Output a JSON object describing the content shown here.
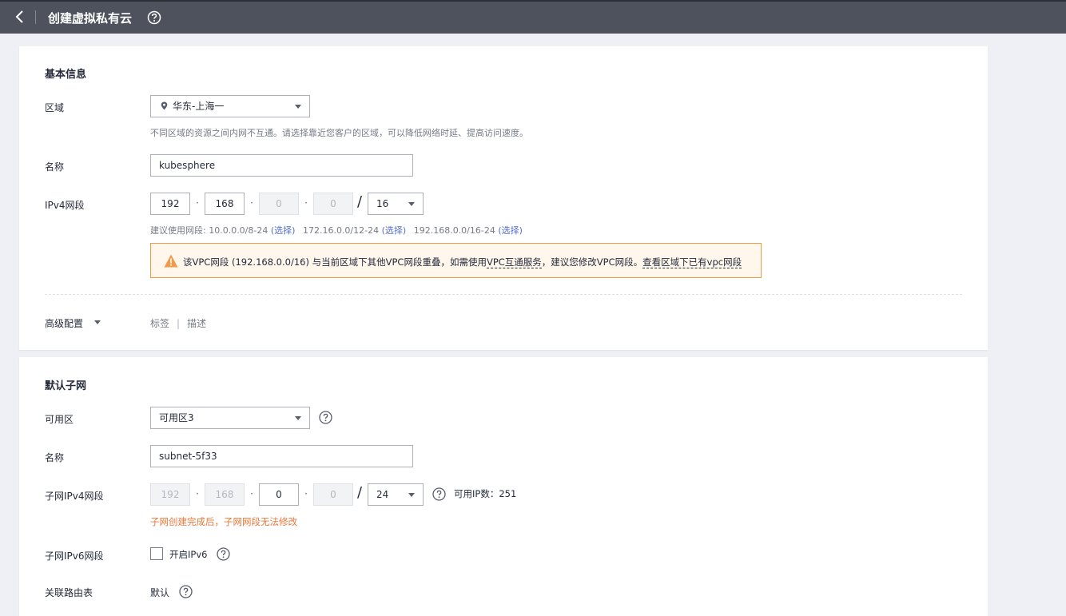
{
  "header": {
    "title": "创建虚拟私有云"
  },
  "basic": {
    "section_title": "基本信息",
    "region_label": "区域",
    "region_value": "华东-上海一",
    "region_hint": "不同区域的资源之间内网不互通。请选择靠近您客户的区域，可以降低网络时延、提高访问速度。",
    "name_label": "名称",
    "name_value": "kubesphere",
    "ipv4_label": "IPv4网段",
    "ip": {
      "o1": "192",
      "o2": "168",
      "o3": "0",
      "o4": "0",
      "mask": "16"
    },
    "suggest_prefix": "建议使用网段: 10.0.0.0/8-24",
    "suggest_2": "172.16.0.0/12-24",
    "suggest_3": "192.168.0.0/16-24",
    "select_link": "(选择)",
    "warning": {
      "text_1": "该VPC网段 (192.168.0.0/16) 与当前区域下其他VPC网段重叠，如需使用",
      "link_1": "VPC互通服务",
      "text_2": "，建议您修改VPC网段。",
      "link_2": "查看区域下已有vpc网段"
    },
    "advanced_label": "高级配置",
    "advanced_items": [
      "标签",
      "描述"
    ]
  },
  "subnet": {
    "section_title": "默认子网",
    "az_label": "可用区",
    "az_value": "可用区3",
    "name_label": "名称",
    "name_value": "subnet-5f33",
    "ipv4_label": "子网IPv4网段",
    "ip": {
      "o1": "192",
      "o2": "168",
      "o3": "0",
      "o4": "0",
      "mask": "24"
    },
    "available_ip": "可用IP数：251",
    "notice": "子网创建完成后，子网网段无法修改",
    "ipv6_label": "子网IPv6网段",
    "ipv6_checkbox": "开启IPv6",
    "route_label": "关联路由表",
    "route_value": "默认"
  },
  "icons": [
    "back-icon",
    "help-icon",
    "location-pin-icon",
    "caret-down-icon",
    "warning-icon"
  ],
  "colors": {
    "header": "#4d525d",
    "link": "#526ecc",
    "warning": "#f2994a",
    "notice": "#e8773a"
  }
}
